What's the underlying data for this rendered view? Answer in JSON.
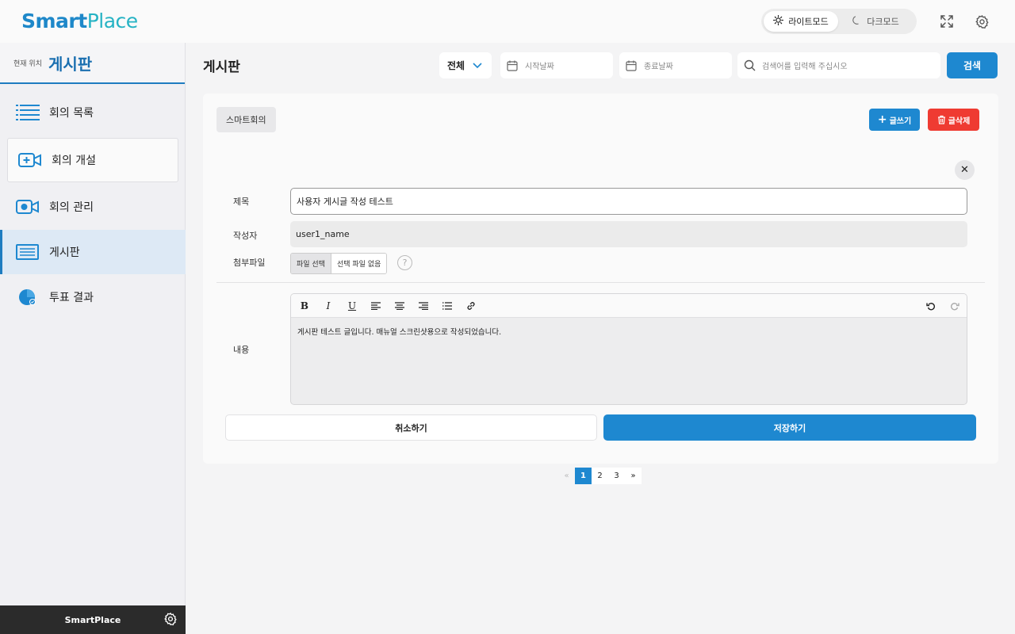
{
  "header": {
    "logo_part1": "Smart",
    "logo_part2": "Place",
    "light_mode_label": "라이트모드",
    "dark_mode_label": "다크모드"
  },
  "sidebar": {
    "location_label": "현재 위치",
    "location_value": "게시판",
    "items": [
      {
        "label": "회의 목록",
        "icon": "list-icon"
      },
      {
        "label": "회의 개설",
        "icon": "video-add-icon"
      },
      {
        "label": "회의 관리",
        "icon": "video-settings-icon"
      },
      {
        "label": "게시판",
        "icon": "board-icon"
      },
      {
        "label": "투표 결과",
        "icon": "pie-chart-icon"
      }
    ],
    "footer_label": "SmartPlace"
  },
  "main": {
    "page_title": "게시판",
    "filter_select": "전체",
    "start_date_placeholder": "시작날짜",
    "end_date_placeholder": "종료날짜",
    "search_placeholder": "검색어를 입력해 주십시오",
    "search_button": "검색"
  },
  "card": {
    "category": "스마트회의",
    "write_button": "글쓰기",
    "delete_button": "글삭제",
    "title_label": "제목",
    "title_value": "사용자 게시글 작성 테스트",
    "author_label": "작성자",
    "author_value": "user1_name",
    "attachment_label": "첨부파일",
    "file_choose": "파일 선택",
    "file_none": "선택 파일 없음",
    "help": "?",
    "content_label": "내용",
    "content_value": "게시판 테스트 글입니다. 매뉴얼 스크린샷용으로 작성되었습니다.",
    "cancel_button": "취소하기",
    "save_button": "저장하기"
  },
  "toolbar": {
    "bold": "B",
    "italic": "I",
    "underline": "U"
  },
  "pagination": {
    "prev": "«",
    "pages": [
      "1",
      "2",
      "3"
    ],
    "next": "»",
    "current": "1"
  },
  "colors": {
    "accent": "#1e88d0",
    "danger": "#ef3b32",
    "logo_smart": "#1e88c9",
    "logo_place": "#26b3c4"
  }
}
